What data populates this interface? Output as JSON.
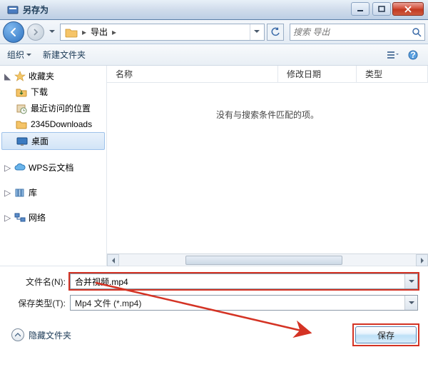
{
  "window": {
    "title": "另存为"
  },
  "nav": {
    "crumb": "导出",
    "search_placeholder": "搜索 导出"
  },
  "toolbar": {
    "organize": "组织",
    "new_folder": "新建文件夹"
  },
  "sidebar": {
    "favorites": {
      "label": "收藏夹",
      "items": [
        {
          "label": "下载"
        },
        {
          "label": "最近访问的位置"
        },
        {
          "label": "2345Downloads"
        },
        {
          "label": "桌面"
        }
      ]
    },
    "wps": {
      "label": "WPS云文档"
    },
    "libraries": {
      "label": "库"
    },
    "network": {
      "label": "网络"
    }
  },
  "fileview": {
    "columns": {
      "name": "名称",
      "modified": "修改日期",
      "type": "类型"
    },
    "empty": "没有与搜索条件匹配的项。"
  },
  "form": {
    "filename_label": "文件名(N):",
    "filename_value": "合并视频.mp4",
    "filetype_label": "保存类型(T):",
    "filetype_value": "Mp4 文件 (*.mp4)"
  },
  "footer": {
    "hide_folders": "隐藏文件夹",
    "save": "保存"
  },
  "annotation": {
    "color": "#d43324"
  }
}
